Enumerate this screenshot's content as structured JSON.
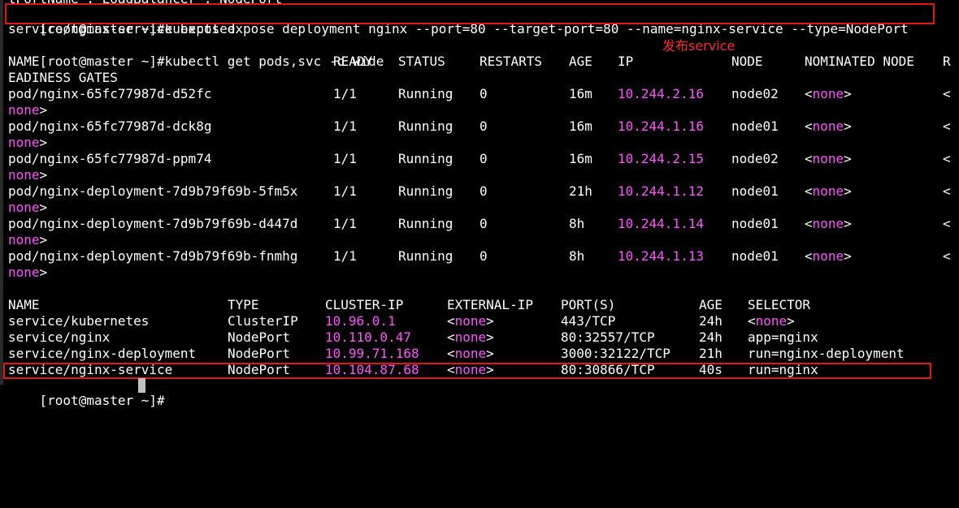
{
  "terminal": {
    "top_partial": "tPortName'; LoadBalancer'; NodePort",
    "commands": [
      {
        "prompt": "[root@master ~]#",
        "text": "kubectl expose deployment nginx --port=80 --target-port=80 --name=nginx-service --type=NodePort"
      },
      {
        "output": "service/nginx-service exposed"
      },
      {
        "prompt": "[root@master ~]#",
        "text": "kubectl get pods,svc -o wide"
      }
    ],
    "annotation": "发布service",
    "pods_header": {
      "name": "NAME",
      "ready": "READY",
      "status": "STATUS",
      "restarts": "RESTARTS",
      "age": "AGE",
      "ip": "IP",
      "node": "NODE",
      "nominated": "NOMINATED NODE",
      "readiness_start": "R",
      "readiness_wrap": "EADINESS GATES"
    },
    "pods": [
      {
        "name": "pod/nginx-65fc77987d-d52fc",
        "ready": "1/1",
        "status": "Running",
        "restarts": "0",
        "age": "16m",
        "ip": "10.244.2.16",
        "node": "node02",
        "nominated": "<none>",
        "readiness_start": "<",
        "wrap": "none>"
      },
      {
        "name": "pod/nginx-65fc77987d-dck8g",
        "ready": "1/1",
        "status": "Running",
        "restarts": "0",
        "age": "16m",
        "ip": "10.244.1.16",
        "node": "node01",
        "nominated": "<none>",
        "readiness_start": "<",
        "wrap": "none>"
      },
      {
        "name": "pod/nginx-65fc77987d-ppm74",
        "ready": "1/1",
        "status": "Running",
        "restarts": "0",
        "age": "16m",
        "ip": "10.244.2.15",
        "node": "node02",
        "nominated": "<none>",
        "readiness_start": "<",
        "wrap": "none>"
      },
      {
        "name": "pod/nginx-deployment-7d9b79f69b-5fm5x",
        "ready": "1/1",
        "status": "Running",
        "restarts": "0",
        "age": "21h",
        "ip": "10.244.1.12",
        "node": "node01",
        "nominated": "<none>",
        "readiness_start": "<",
        "wrap": "none>"
      },
      {
        "name": "pod/nginx-deployment-7d9b79f69b-d447d",
        "ready": "1/1",
        "status": "Running",
        "restarts": "0",
        "age": "8h",
        "ip": "10.244.1.14",
        "node": "node01",
        "nominated": "<none>",
        "readiness_start": "<",
        "wrap": "none>"
      },
      {
        "name": "pod/nginx-deployment-7d9b79f69b-fnmhg",
        "ready": "1/1",
        "status": "Running",
        "restarts": "0",
        "age": "8h",
        "ip": "10.244.1.13",
        "node": "node01",
        "nominated": "<none>",
        "readiness_start": "<",
        "wrap": "none>"
      }
    ],
    "svc_header": {
      "name": "NAME",
      "type": "TYPE",
      "cluster_ip": "CLUSTER-IP",
      "external_ip": "EXTERNAL-IP",
      "ports": "PORT(S)",
      "age": "AGE",
      "selector": "SELECTOR"
    },
    "services": [
      {
        "name": "service/kubernetes",
        "type": "ClusterIP",
        "cluster_ip": "10.96.0.1",
        "external_ip": "<none>",
        "ports": "443/TCP",
        "age": "24h",
        "selector": "<none>"
      },
      {
        "name": "service/nginx",
        "type": "NodePort",
        "cluster_ip": "10.110.0.47",
        "external_ip": "<none>",
        "ports": "80:32557/TCP",
        "age": "24h",
        "selector": "app=nginx"
      },
      {
        "name": "service/nginx-deployment",
        "type": "NodePort",
        "cluster_ip": "10.99.71.168",
        "external_ip": "<none>",
        "ports": "3000:32122/TCP",
        "age": "21h",
        "selector": "run=nginx-deployment"
      },
      {
        "name": "service/nginx-service",
        "type": "NodePort",
        "cluster_ip": "10.104.87.68",
        "external_ip": "<none>",
        "ports": "80:30866/TCP",
        "age": "40s",
        "selector": "run=nginx"
      }
    ],
    "bottom_prompt": "[root@master ~]#",
    "colors": {
      "background": "#000000",
      "text": "#ffffff",
      "ip_magenta": "#ff55ff",
      "highlight_red": "#e01818",
      "annotation_red": "#ff2a2a"
    }
  }
}
